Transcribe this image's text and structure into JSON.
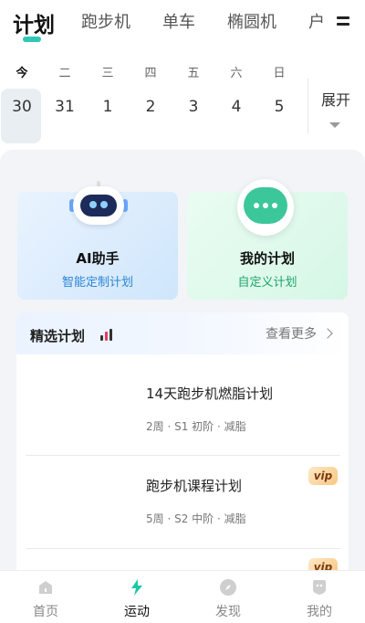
{
  "tabs": [
    {
      "label": "计划",
      "active": true
    },
    {
      "label": "跑步机",
      "active": false
    },
    {
      "label": "单车",
      "active": false
    },
    {
      "label": "椭圆机",
      "active": false
    },
    {
      "label": "户",
      "active": false
    }
  ],
  "calendar": {
    "weekdays": [
      "今",
      "二",
      "三",
      "四",
      "五",
      "六",
      "日"
    ],
    "days": [
      "30",
      "31",
      "1",
      "2",
      "3",
      "4",
      "5"
    ],
    "selected_index": 0,
    "expand_label": "展开"
  },
  "cards": {
    "ai": {
      "title": "AI助手",
      "subtitle": "智能定制计划",
      "icon": "robot-icon"
    },
    "plan": {
      "title": "我的计划",
      "subtitle": "自定义计划",
      "icon": "chat-bubble-icon"
    }
  },
  "featured": {
    "title": "精选计划",
    "more_label": "查看更多",
    "items": [
      {
        "title": "14天跑步机燃脂计划",
        "meta": "2周 · S1 初阶 · 减脂",
        "vip": ""
      },
      {
        "title": "跑步机课程计划",
        "meta": "5周 · S2 中阶 · 减脂",
        "vip": "vip"
      },
      {
        "title": "",
        "meta": "",
        "vip": "vip"
      }
    ]
  },
  "bottom_nav": [
    {
      "label": "首页",
      "icon": "home-icon",
      "active": false
    },
    {
      "label": "运动",
      "icon": "lightning-icon",
      "active": true
    },
    {
      "label": "发现",
      "icon": "compass-icon",
      "active": false
    },
    {
      "label": "我的",
      "icon": "profile-icon",
      "active": false
    }
  ],
  "colors": {
    "accent": "#33c7b8",
    "ai_card": "#cfe6fb",
    "plan_card": "#d6f7e6",
    "vip_gold": "#f9c784"
  }
}
